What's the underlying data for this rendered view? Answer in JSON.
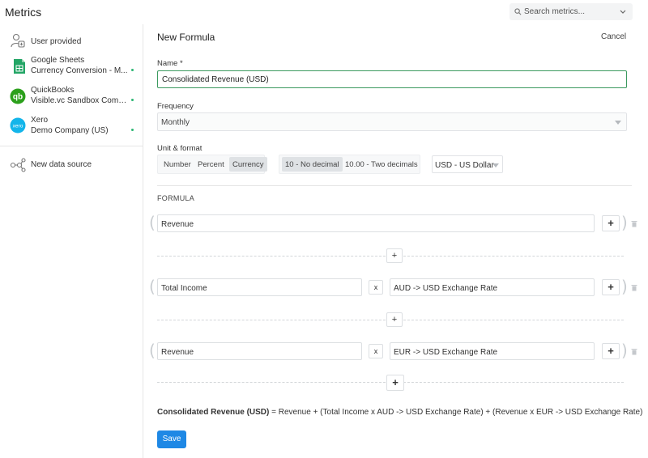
{
  "app": {
    "title": "Metrics"
  },
  "search": {
    "placeholder": "Search metrics..."
  },
  "sidebar": {
    "sources": [
      {
        "name": "User provided",
        "subtitle": "",
        "icon": "user-add-icon",
        "connected": false
      },
      {
        "name": "Google Sheets",
        "subtitle": "Currency Conversion - M...",
        "icon": "google-sheets-icon",
        "connected": true
      },
      {
        "name": "QuickBooks",
        "subtitle": "Visible.vc Sandbox Comp...",
        "icon": "quickbooks-icon",
        "connected": true
      },
      {
        "name": "Xero",
        "subtitle": "Demo Company (US)",
        "icon": "xero-icon",
        "connected": true
      }
    ],
    "new_source_label": "New data source",
    "xero_logo_text": "xero"
  },
  "form": {
    "title": "New Formula",
    "cancel_label": "Cancel",
    "name_label": "Name *",
    "name_value": "Consolidated Revenue (USD)",
    "frequency_label": "Frequency",
    "frequency_value": "Monthly",
    "unit_label": "Unit & format",
    "unit_options": [
      "Number",
      "Percent",
      "Currency"
    ],
    "unit_selected": "Currency",
    "decimal_options": [
      "10 - No decimal",
      "10.00 - Two decimals"
    ],
    "decimal_selected": "10 - No decimal",
    "currency_value": "USD - US Dollar",
    "formula_label": "FORMULA",
    "groups": [
      {
        "terms": [
          "Revenue"
        ],
        "operator": ""
      },
      {
        "terms": [
          "Total Income",
          "AUD -> USD Exchange Rate"
        ],
        "operator": "x"
      },
      {
        "terms": [
          "Revenue",
          "EUR -> USD Exchange Rate"
        ],
        "operator": "x"
      }
    ],
    "add_symbol": "+",
    "summary_name": "Consolidated Revenue (USD)",
    "summary_expression": "= Revenue + (Total Income x AUD -> USD Exchange Rate) + (Revenue x EUR -> USD Exchange Rate)",
    "save_label": "Save"
  },
  "colors": {
    "accent": "#1e88e5",
    "focus_border": "#3c9a5f",
    "connected_dot": "#2bb673",
    "sheets_green": "#23a566",
    "quickbooks_green": "#2ca01c",
    "xero_blue": "#13b5ea"
  }
}
